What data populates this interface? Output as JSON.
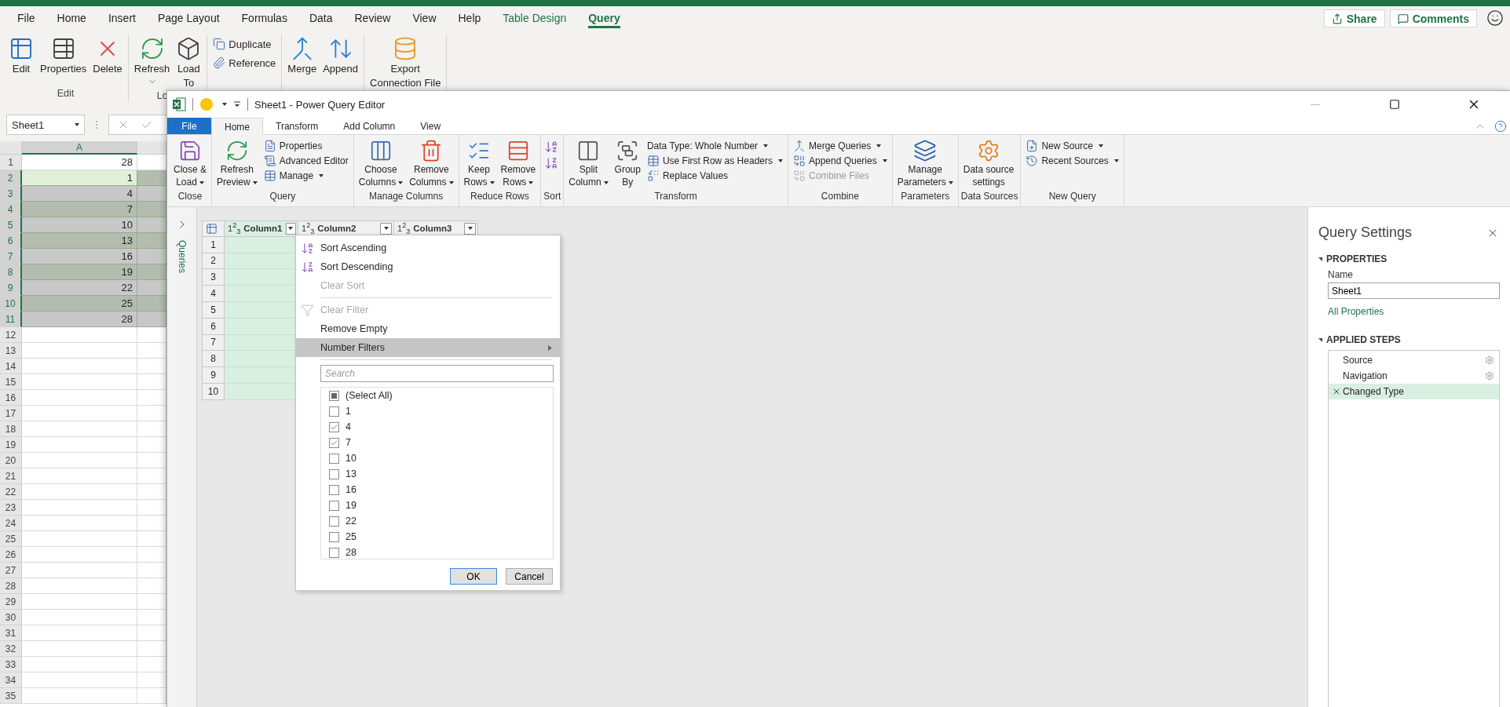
{
  "excel": {
    "tabs": [
      {
        "label": "File",
        "selected": false,
        "kind": "plain"
      },
      {
        "label": "Home",
        "selected": false,
        "kind": "plain"
      },
      {
        "label": "Insert",
        "selected": false,
        "kind": "plain"
      },
      {
        "label": "Page Layout",
        "selected": false,
        "kind": "plain"
      },
      {
        "label": "Formulas",
        "selected": false,
        "kind": "plain"
      },
      {
        "label": "Data",
        "selected": false,
        "kind": "plain"
      },
      {
        "label": "Review",
        "selected": false,
        "kind": "plain"
      },
      {
        "label": "View",
        "selected": false,
        "kind": "plain"
      },
      {
        "label": "Help",
        "selected": false,
        "kind": "plain"
      },
      {
        "label": "Table Design",
        "selected": false,
        "kind": "contextual"
      },
      {
        "label": "Query",
        "selected": true,
        "kind": "contextual"
      }
    ],
    "share": "Share",
    "comments": "Comments",
    "ribbon": [
      {
        "label": "Edit",
        "items": [
          {
            "kind": "large",
            "lines": [
              "Edit"
            ],
            "dropdown": false
          },
          {
            "kind": "large",
            "lines": [
              "Properties"
            ],
            "dropdown": false
          },
          {
            "kind": "large",
            "lines": [
              "Delete"
            ],
            "dropdown": false
          }
        ]
      },
      {
        "label": "Lo",
        "items": [
          {
            "kind": "large",
            "lines": [
              "Refresh"
            ],
            "dropdown": true
          },
          {
            "kind": "large",
            "lines": [
              "Load",
              "To"
            ],
            "dropdown": false
          }
        ]
      },
      {
        "items": [
          {
            "kind": "stack",
            "items": [
              {
                "label": "Duplicate",
                "dropdown": false,
                "disabled": false
              },
              {
                "label": "Reference",
                "dropdown": false,
                "disabled": false
              }
            ]
          }
        ]
      },
      {
        "items": [
          {
            "kind": "large",
            "lines": [
              "Merge"
            ],
            "dropdown": false
          },
          {
            "kind": "large",
            "lines": [
              "Append"
            ],
            "dropdown": false
          }
        ]
      },
      {
        "items": [
          {
            "kind": "large",
            "lines": [
              "Export",
              "Connection File"
            ],
            "dropdown": false
          }
        ]
      }
    ],
    "name_box": "Sheet1",
    "sheet": {
      "column": {
        "label": "A",
        "selected": true
      },
      "rows": [
        {
          "number": "1",
          "value": "28",
          "selected": false,
          "active": false
        },
        {
          "number": "2",
          "value": "1",
          "selected": true,
          "active": true
        },
        {
          "number": "3",
          "value": "4",
          "selected": true,
          "active": false
        },
        {
          "number": "4",
          "value": "7",
          "selected": true,
          "active": false
        },
        {
          "number": "5",
          "value": "10",
          "selected": true,
          "active": false
        },
        {
          "number": "6",
          "value": "13",
          "selected": true,
          "active": false
        },
        {
          "number": "7",
          "value": "16",
          "selected": true,
          "active": false
        },
        {
          "number": "8",
          "value": "19",
          "selected": true,
          "active": false
        },
        {
          "number": "9",
          "value": "22",
          "selected": true,
          "active": false
        },
        {
          "number": "10",
          "value": "25",
          "selected": true,
          "active": false
        },
        {
          "number": "11",
          "value": "28",
          "selected": true,
          "active": false
        },
        {
          "number": "12",
          "selected": false,
          "active": false
        },
        {
          "number": "13",
          "selected": false,
          "active": false
        },
        {
          "number": "14",
          "selected": false,
          "active": false
        },
        {
          "number": "15",
          "selected": false,
          "active": false
        },
        {
          "number": "16",
          "selected": false,
          "active": false
        },
        {
          "number": "17",
          "selected": false,
          "active": false
        },
        {
          "number": "18",
          "selected": false,
          "active": false
        },
        {
          "number": "19",
          "selected": false,
          "active": false
        },
        {
          "number": "20",
          "selected": false,
          "active": false
        },
        {
          "number": "21",
          "selected": false,
          "active": false
        },
        {
          "number": "22",
          "selected": false,
          "active": false
        },
        {
          "number": "23",
          "selected": false,
          "active": false
        },
        {
          "number": "24",
          "selected": false,
          "active": false
        },
        {
          "number": "25",
          "selected": false,
          "active": false
        },
        {
          "number": "26",
          "selected": false,
          "active": false
        },
        {
          "number": "27",
          "selected": false,
          "active": false
        },
        {
          "number": "28",
          "selected": false,
          "active": false
        },
        {
          "number": "29",
          "selected": false,
          "active": false
        },
        {
          "number": "30",
          "selected": false,
          "active": false
        },
        {
          "number": "31",
          "selected": false,
          "active": false
        },
        {
          "number": "32",
          "selected": false,
          "active": false
        },
        {
          "number": "33",
          "selected": false,
          "active": false
        },
        {
          "number": "34",
          "selected": false,
          "active": false
        },
        {
          "number": "35",
          "selected": false,
          "active": false
        }
      ]
    }
  },
  "editor": {
    "title": "Sheet1 - Power Query Editor",
    "tabs": [
      {
        "label": "File",
        "selected": false,
        "kind": "file"
      },
      {
        "label": "Home",
        "selected": true,
        "kind": "plain"
      },
      {
        "label": "Transform",
        "selected": false,
        "kind": "plain"
      },
      {
        "label": "Add Column",
        "selected": false,
        "kind": "plain"
      },
      {
        "label": "View",
        "selected": false,
        "kind": "plain"
      }
    ],
    "ribbon": [
      {
        "label": "Close",
        "items": [
          {
            "kind": "large",
            "lines": [
              "Close &",
              "Load"
            ],
            "dropdown": true
          }
        ]
      },
      {
        "label": "Query",
        "items": [
          {
            "kind": "large",
            "lines": [
              "Refresh",
              "Preview"
            ],
            "dropdown": true
          },
          {
            "kind": "stack",
            "items": [
              {
                "label": "Properties",
                "dropdown": false,
                "disabled": false
              },
              {
                "label": "Advanced Editor",
                "dropdown": false,
                "disabled": false
              },
              {
                "label": "Manage",
                "dropdown": true,
                "disabled": false
              }
            ]
          }
        ]
      },
      {
        "label": "Manage Columns",
        "items": [
          {
            "kind": "large",
            "lines": [
              "Choose",
              "Columns"
            ],
            "dropdown": true
          },
          {
            "kind": "large",
            "lines": [
              "Remove",
              "Columns"
            ],
            "dropdown": true
          }
        ]
      },
      {
        "label": "Reduce Rows",
        "items": [
          {
            "kind": "large",
            "lines": [
              "Keep",
              "Rows"
            ],
            "dropdown": true
          },
          {
            "kind": "large",
            "lines": [
              "Remove",
              "Rows"
            ],
            "dropdown": true
          }
        ]
      },
      {
        "label": "Sort",
        "items": [
          {
            "kind": "icons"
          }
        ]
      },
      {
        "label": "Transform",
        "items": [
          {
            "kind": "large",
            "lines": [
              "Split",
              "Column"
            ],
            "dropdown": true
          },
          {
            "kind": "large",
            "lines": [
              "Group",
              "By"
            ],
            "dropdown": false
          },
          {
            "kind": "stack",
            "items": [
              {
                "label": "Data Type: Whole Number",
                "dropdown": true,
                "disabled": false
              },
              {
                "label": "Use First Row as Headers",
                "dropdown": true,
                "disabled": false
              },
              {
                "label": "Replace Values",
                "dropdown": false,
                "disabled": false
              }
            ]
          }
        ]
      },
      {
        "label": "Combine",
        "items": [
          {
            "kind": "stack",
            "items": [
              {
                "label": "Merge Queries",
                "dropdown": true,
                "disabled": false
              },
              {
                "label": "Append Queries",
                "dropdown": true,
                "disabled": false
              },
              {
                "label": "Combine Files",
                "dropdown": false,
                "disabled": true
              }
            ]
          }
        ]
      },
      {
        "label": "Parameters",
        "items": [
          {
            "kind": "large",
            "lines": [
              "Manage",
              "Parameters"
            ],
            "dropdown": true
          }
        ]
      },
      {
        "label": "Data Sources",
        "items": [
          {
            "kind": "large",
            "lines": [
              "Data source",
              "settings"
            ],
            "dropdown": false
          }
        ]
      },
      {
        "label": "New Query",
        "items": [
          {
            "kind": "stack",
            "items": [
              {
                "label": "New Source",
                "dropdown": true,
                "disabled": false
              },
              {
                "label": "Recent Sources",
                "dropdown": true,
                "disabled": false
              }
            ]
          }
        ]
      }
    ],
    "queries_label": "Queries",
    "table": {
      "columns": [
        {
          "type_label": "1$^{2}$$_{3}$",
          "name": "Column1",
          "selected": true
        },
        {
          "type_label": "1$^{2}$$_{3}$",
          "name": "Column2",
          "selected": false
        },
        {
          "type_label": "1$^{2}$$_{3}$",
          "name": "Column3",
          "selected": false
        }
      ],
      "row_numbers": [
        "1",
        "2",
        "3",
        "4",
        "5",
        "6",
        "7",
        "8",
        "9",
        "10"
      ]
    },
    "filter_menu": {
      "items": [
        {
          "kind": "item",
          "label": "Sort Ascending",
          "disabled": false,
          "selected": false
        },
        {
          "kind": "item",
          "label": "Sort Descending",
          "disabled": false,
          "selected": false
        },
        {
          "kind": "item",
          "label": "Clear Sort",
          "disabled": true,
          "selected": false
        },
        {
          "kind": "separator"
        },
        {
          "kind": "item",
          "label": "Clear Filter",
          "disabled": true,
          "selected": false
        },
        {
          "kind": "item",
          "label": "Remove Empty",
          "disabled": false,
          "selected": false
        },
        {
          "kind": "submenu",
          "label": "Number Filters",
          "disabled": false,
          "selected": true
        }
      ],
      "search": {
        "placeholder": "Search"
      },
      "select_all": {
        "label": "(Select All)",
        "indeterminate": true
      },
      "values": [
        {
          "label": "1",
          "checked": false
        },
        {
          "label": "4",
          "checked": true
        },
        {
          "label": "7",
          "checked": true
        },
        {
          "label": "10",
          "checked": false
        },
        {
          "label": "13",
          "checked": false
        },
        {
          "label": "16",
          "checked": false
        },
        {
          "label": "19",
          "checked": false
        },
        {
          "label": "22",
          "checked": false
        },
        {
          "label": "25",
          "checked": false
        },
        {
          "label": "28",
          "checked": false
        }
      ],
      "ok": "OK",
      "cancel": "Cancel"
    },
    "settings": {
      "title": "Query Settings",
      "properties_heading": "PROPERTIES",
      "name_label": "Name",
      "name_value": "Sheet1",
      "all_properties": "All Properties",
      "steps_heading": "APPLIED STEPS",
      "steps": [
        {
          "label": "Source",
          "selected": false,
          "has_settings": true
        },
        {
          "label": "Navigation",
          "selected": false,
          "has_settings": true
        },
        {
          "label": "Changed Type",
          "selected": true,
          "has_settings": false
        }
      ]
    }
  }
}
